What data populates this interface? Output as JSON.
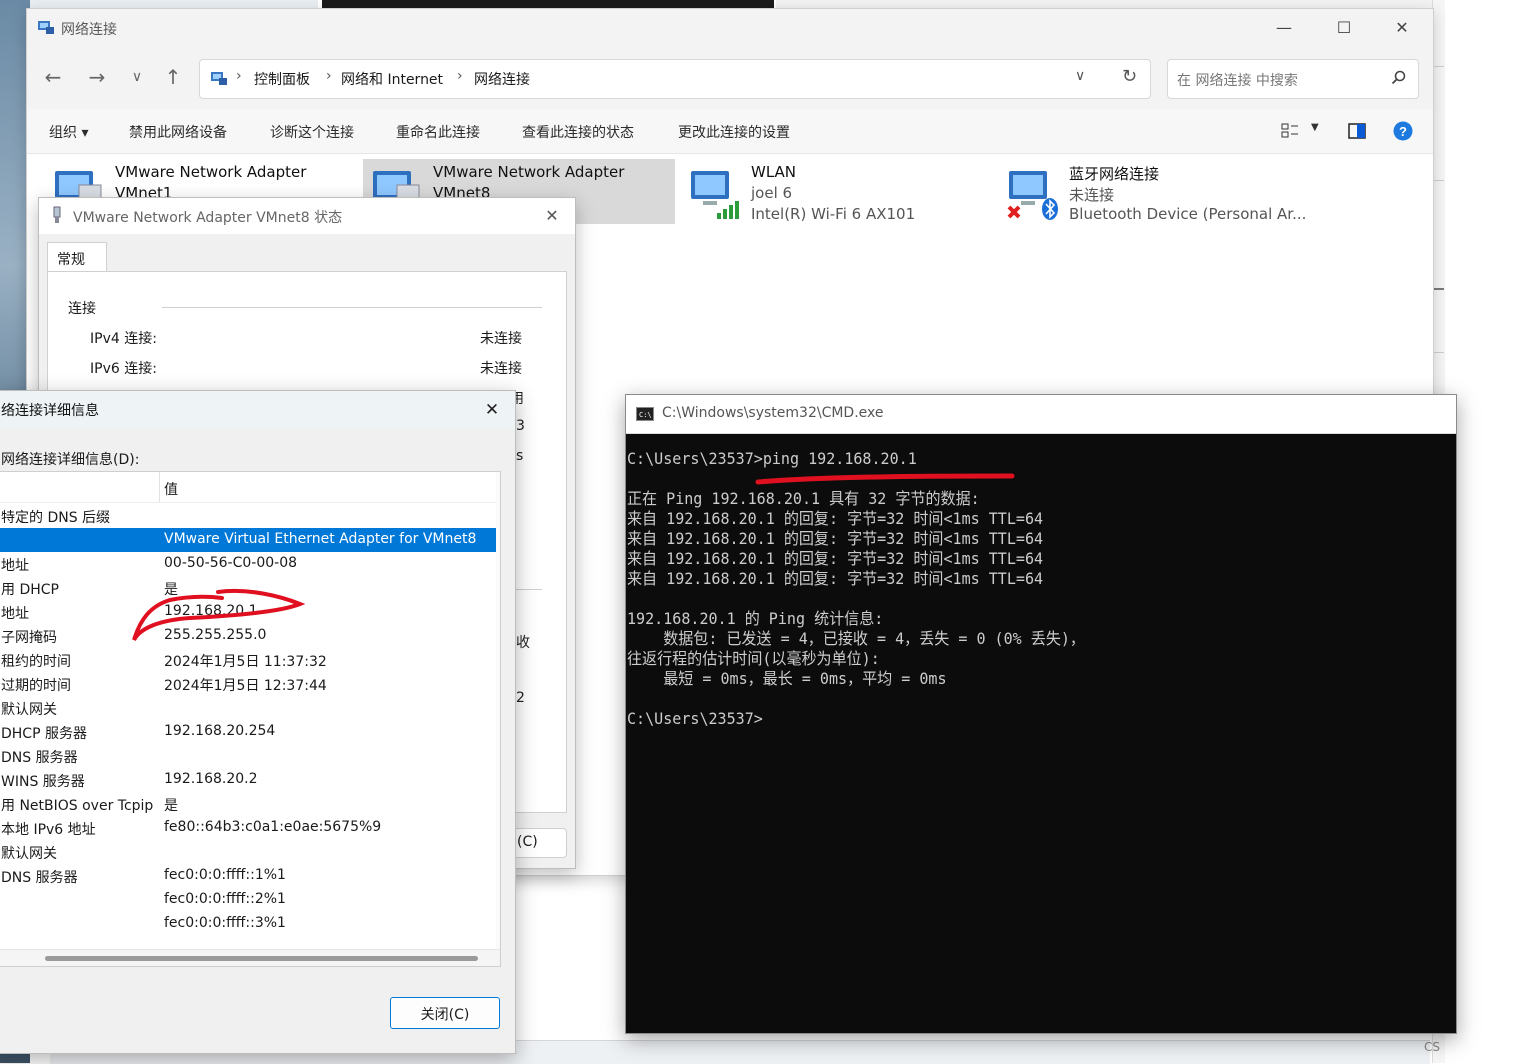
{
  "explorer": {
    "title": "网络连接",
    "breadcrumb": [
      "控制面板",
      "网络和 Internet",
      "网络连接"
    ],
    "search_placeholder": "在 网络连接 中搜索",
    "commands": [
      "组织 ▾",
      "禁用此网络设备",
      "诊断这个连接",
      "重命名此连接",
      "查看此连接的状态",
      "更改此连接的设置"
    ],
    "adapters": [
      {
        "name": "VMware Network Adapter",
        "line2": "VMnet1",
        "line3": "",
        "selected": false
      },
      {
        "name": "VMware Network Adapter",
        "line2": "VMnet8",
        "line3": "",
        "selected": true
      },
      {
        "name": "WLAN",
        "line2": "joel 6",
        "line3": "Intel(R) Wi-Fi 6 AX101",
        "selected": false
      },
      {
        "name": "蓝牙网络连接",
        "line2": "未连接",
        "line3": "Bluetooth Device (Personal Ar...",
        "selected": false
      }
    ]
  },
  "status_dialog": {
    "title": "VMware Network Adapter VMnet8 状态",
    "tab": "常规",
    "group": "连接",
    "rows": [
      {
        "label": "IPv4 连接:",
        "value": "未连接"
      },
      {
        "label": "IPv6 连接:",
        "value": "未连接"
      }
    ],
    "fragments": [
      "用",
      "3",
      "s",
      "收",
      "2"
    ],
    "close_label": "(C)"
  },
  "details_dialog": {
    "title": "络连接详细信息",
    "caption": "网络连接详细信息(D):",
    "col_value": "值",
    "rows": [
      {
        "p": "特定的 DNS 后缀",
        "v": ""
      },
      {
        "p": "",
        "v": "VMware Virtual Ethernet Adapter for VMnet8"
      },
      {
        "p": "地址",
        "v": "00-50-56-C0-00-08"
      },
      {
        "p": "用 DHCP",
        "v": "是"
      },
      {
        "p": "地址",
        "v": "192.168.20.1"
      },
      {
        "p": "子网掩码",
        "v": "255.255.255.0"
      },
      {
        "p": "租约的时间",
        "v": "2024年1月5日 11:37:32"
      },
      {
        "p": "过期的时间",
        "v": "2024年1月5日 12:37:44"
      },
      {
        "p": "默认网关",
        "v": ""
      },
      {
        "p": "DHCP 服务器",
        "v": "192.168.20.254"
      },
      {
        "p": "DNS 服务器",
        "v": ""
      },
      {
        "p": "WINS 服务器",
        "v": "192.168.20.2"
      },
      {
        "p": "用 NetBIOS over Tcpip",
        "v": "是"
      },
      {
        "p": "本地 IPv6 地址",
        "v": "fe80::64b3:c0a1:e0ae:5675%9"
      },
      {
        "p": "默认网关",
        "v": ""
      },
      {
        "p": "DNS 服务器",
        "v": "fec0:0:0:ffff::1%1"
      },
      {
        "p": "",
        "v": "fec0:0:0:ffff::2%1"
      },
      {
        "p": "",
        "v": "fec0:0:0:ffff::3%1"
      }
    ],
    "close_label": "关闭(C)"
  },
  "cmd": {
    "title": "C:\\Windows\\system32\\CMD.exe",
    "lines": [
      "C:\\Users\\23537>ping 192.168.20.1",
      "",
      "正在 Ping 192.168.20.1 具有 32 字节的数据:",
      "来自 192.168.20.1 的回复: 字节=32 时间<1ms TTL=64",
      "来自 192.168.20.1 的回复: 字节=32 时间<1ms TTL=64",
      "来自 192.168.20.1 的回复: 字节=32 时间<1ms TTL=64",
      "来自 192.168.20.1 的回复: 字节=32 时间<1ms TTL=64",
      "",
      "192.168.20.1 的 Ping 统计信息:",
      "    数据包: 已发送 = 4，已接收 = 4，丢失 = 0 (0% 丢失)，",
      "往返行程的估计时间(以毫秒为单位):",
      "    最短 = 0ms，最长 = 0ms，平均 = 0ms",
      "",
      "C:\\Users\\23537>"
    ]
  },
  "corner_text": "CS",
  "colors": {
    "selection": "#0078d7",
    "annotation": "#e01020",
    "terminal_bg": "#0c0c0c"
  }
}
